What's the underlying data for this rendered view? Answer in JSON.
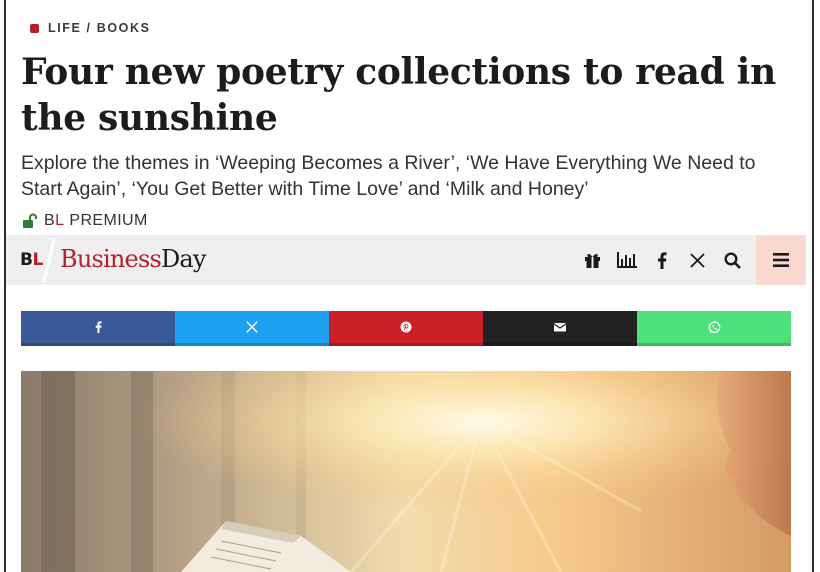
{
  "article": {
    "category": "LIFE / BOOKS",
    "headline": "Four new poetry collections to read in the sunshine",
    "subheadline": "Explore the themes in ‘Weeping Becomes a River’, ‘We Have Everything We Need to Start Again’, ‘You Get Better with Time Love’ and ‘Milk and Honey’",
    "premium": {
      "b": "B",
      "l": "L",
      "label": "PREMIUM"
    }
  },
  "navbar": {
    "logo_b": "B",
    "logo_l": "L",
    "brand_business": "Business",
    "brand_day": "Day",
    "icons": [
      "gift-icon",
      "chart-icon",
      "facebook-icon",
      "x-icon",
      "search-icon",
      "menu-icon"
    ]
  },
  "share": {
    "buttons": [
      {
        "name": "facebook",
        "color": "#3b5998"
      },
      {
        "name": "x-twitter",
        "color": "#1da1f2"
      },
      {
        "name": "pinterest",
        "color": "#cb2027"
      },
      {
        "name": "email",
        "color": "#222222"
      },
      {
        "name": "whatsapp",
        "color": "#4ee07a"
      }
    ]
  },
  "colors": {
    "accent": "#b51f2a",
    "navbar_bg": "#efefef",
    "menu_bg": "#f8d8cf"
  }
}
